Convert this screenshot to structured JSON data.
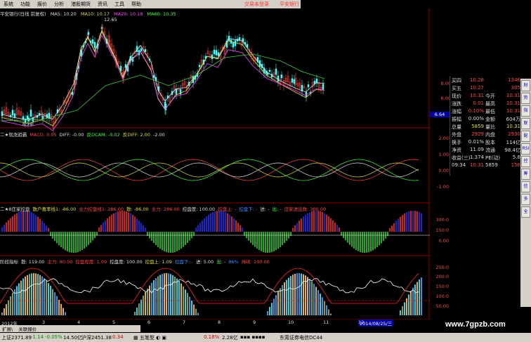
{
  "menu": [
    "系统",
    "功能",
    "报价",
    "分析",
    "港股期货",
    "资讯",
    "工具",
    "帮助"
  ],
  "toplinks": [
    "交易未登录",
    "平安银行"
  ],
  "main_panel": {
    "title": "平安银行(日线 前复权)",
    "ma5": "MA5: 10.20",
    "ma10": "MA10: 10.17",
    "ma20": "MA20: 10.18",
    "ma60": "MA60: 10.35",
    "high_label": "12.65",
    "low_label": "6.28",
    "price_tag": "6.64",
    "axis": [
      "8.00",
      "6.00"
    ]
  },
  "panel2": {
    "title": "二★就涨趋霸",
    "items": [
      {
        "t": "MACD: 0.05",
        "c": "#ff4444"
      },
      {
        "t": "DIFF: -0.00",
        "c": "#dddddd"
      },
      {
        "t": "反DCAM: -0.02",
        "c": "#44ff44"
      },
      {
        "t": "反DIFF: 2.00",
        "c": "#dddd44"
      },
      {
        "t": "-2.00",
        "c": "#dddddd"
      }
    ],
    "axis": [
      "2.00",
      "1.00",
      "0.00",
      "-1.00"
    ]
  },
  "panel3": {
    "title": "二★8庄家控盘",
    "items": [
      {
        "t": "散户喜率线1: -86.00",
        "c": "#dddd44"
      },
      {
        "t": "主力控盘线1: 286.00",
        "c": "#ff4444"
      },
      {
        "t": "散: -86.00",
        "c": "#dddd44"
      },
      {
        "t": "主力: 286.00",
        "c": "#ff4444"
      },
      {
        "t": "控盘度: 100.00",
        "c": "#dddddd"
      },
      {
        "t": "控盘上: -",
        "c": "#ff4444"
      },
      {
        "t": "控盘下: -",
        "c": "#4488ff"
      },
      {
        "t": "进: -",
        "c": "#dddddd"
      },
      {
        "t": "出: -",
        "c": "#44ff44"
      },
      {
        "t": "庄家进出数: 300.00",
        "c": "#ff4444"
      }
    ],
    "axis": [
      "300.0",
      "150.0",
      "0.00"
    ]
  },
  "panel4": {
    "title": "阶段指标",
    "items": [
      {
        "t": "散: 119.00",
        "c": "#dddddd"
      },
      {
        "t": "主力: 80.00",
        "c": "#ff4444"
      },
      {
        "t": "控盘程度: 1.09",
        "c": "#ff4444"
      },
      {
        "t": "控盘度: 100.00",
        "c": "#dddddd"
      },
      {
        "t": "控盘上: 1.09",
        "c": "#dddd44"
      },
      {
        "t": "控盘下: -",
        "c": "#4488ff"
      },
      {
        "t": "进: 5.00",
        "c": "#dddddd"
      },
      {
        "t": "出: -",
        "c": "#44ff44"
      },
      {
        "t": "86%",
        "c": "#4488ff"
      },
      {
        "t": "持续: 100.00",
        "c": "#ff4444"
      }
    ],
    "axis": [
      "250.0",
      "200.0",
      "150.0",
      "100.0",
      "50.00"
    ]
  },
  "date_axis": {
    "left": "2012年",
    "right": "2014/08/25/三",
    "ticks": [
      "3",
      "4",
      "5",
      "6",
      "7",
      "8",
      "9",
      "10",
      "11",
      "12"
    ]
  },
  "quote": {
    "rows": [
      {
        "l": "买四",
        "v1": "10.28",
        "l2": "",
        "v2": "1346",
        "c1": "#ff4444"
      },
      {
        "l": "买五",
        "v1": "10.27",
        "l2": "",
        "v2": "305",
        "c1": "#ff4444"
      },
      {
        "l": "现价",
        "v1": "10.31",
        "l2": "今开",
        "v2": "10.31",
        "c1": "#ff4444"
      },
      {
        "l": "涨跌",
        "v1": "0.01",
        "l2": "最高",
        "v2": "10.31",
        "c1": "#ff4444"
      },
      {
        "l": "涨幅",
        "v1": "0.10%",
        "l2": "最低",
        "v2": "10.31",
        "c1": "#ff4444"
      },
      {
        "l": "振幅",
        "v1": "0.00%",
        "l2": "金额",
        "v2": "604万",
        "c1": "#dddddd"
      },
      {
        "l": "总量",
        "v1": "5859",
        "l2": "量比",
        "v2": "10.31",
        "c1": "#dddd44"
      },
      {
        "l": "外盘",
        "v1": "2929",
        "l2": "内盘",
        "v2": "2930",
        "c1": "#ff4444"
      },
      {
        "l": "换手",
        "v1": "0.01%",
        "l2": "股本",
        "v2": "114亿",
        "c1": "#dddddd"
      },
      {
        "l": "净资",
        "v1": "11.09",
        "l2": "流通",
        "v2": "98.4亿",
        "c1": "#dddddd"
      },
      {
        "l": "收益(三)",
        "v1": "1.374",
        "l2": "PE(动)",
        "v2": "5.6",
        "c1": "#dddddd"
      },
      {
        "l": "09:34",
        "v1": "10.31",
        "l2": "5859",
        "v2": "156",
        "c1": "#ff4444"
      }
    ]
  },
  "vtabs": [
    "财",
    "势",
    "指",
    "联",
    "配",
    "RSI",
    "控",
    "筹",
    "信",
    "多",
    "全"
  ],
  "tabs": [
    "扩展\\",
    "关联报价"
  ],
  "status": {
    "sh": "上证2371.89",
    "sh_chg": "-1.14",
    "sh_pct": "-0.05%",
    "sh_amt": "14.50亿",
    "sz": "沪深2451.38",
    "sz_chg": "0.34",
    "pct2": "0.18%",
    "amt2": "2.28亿",
    "broker": "东莞证券电信DC44"
  },
  "watermark": "www.7gpzb.com",
  "colors": {
    "up": "#ff3333",
    "down": "#00cc00",
    "bg": "#000000",
    "menu": "#d4d0c8"
  }
}
